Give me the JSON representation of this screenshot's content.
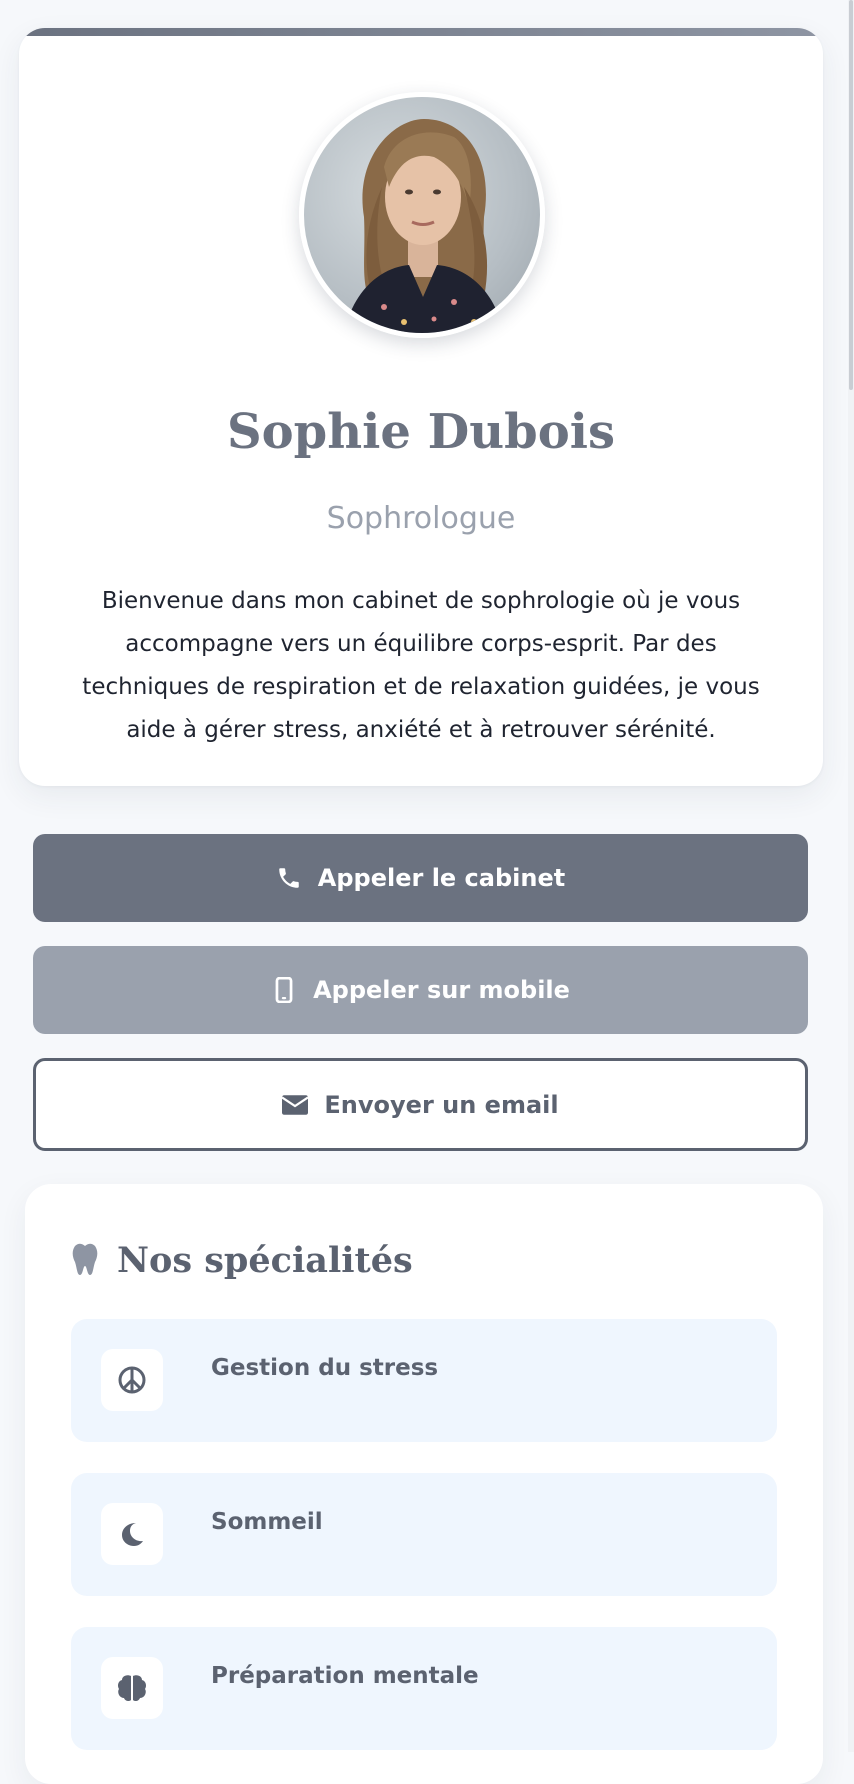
{
  "profile": {
    "name": "Sophie Dubois",
    "title": "Sophrologue",
    "bio": "Bienvenue dans mon cabinet de sophrologie où je vous accompagne vers un équilibre corps-esprit. Par des techniques de respiration et de relaxation guidées, je vous aide à gérer stress, anxiété et à retrouver sérénité.",
    "photo_icon": "portrait-photo"
  },
  "actions": {
    "call_office": {
      "label": "Appeler le cabinet",
      "icon": "phone-icon"
    },
    "call_mobile": {
      "label": "Appeler sur mobile",
      "icon": "mobile-icon"
    },
    "email": {
      "label": "Envoyer un email",
      "icon": "envelope-icon"
    }
  },
  "specialties": {
    "heading": "Nos spécialités",
    "heading_icon": "tooth-icon",
    "items": [
      {
        "label": "Gestion du stress",
        "icon": "peace-icon"
      },
      {
        "label": "Sommeil",
        "icon": "moon-icon"
      },
      {
        "label": "Préparation mentale",
        "icon": "brain-icon"
      }
    ]
  },
  "colors": {
    "primary": "#6b7280",
    "secondary": "#9aa1ad",
    "item_background": "#eff6fe",
    "page_background": "#f6f8fb"
  }
}
